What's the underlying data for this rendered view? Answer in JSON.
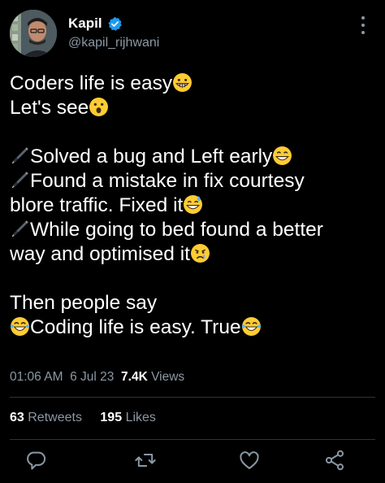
{
  "author": {
    "name": "Kapil",
    "handle": "@kapil_rijhwani",
    "verified": true
  },
  "icons": {
    "more": "more-vertical-icon",
    "verified": "verified-badge-icon",
    "pen": "fountain-pen-emoji",
    "grin": "grinning-face-emoji",
    "wow": "astonished-face-emoji",
    "smile": "smiling-face-emoji",
    "sweat": "sweat-smile-emoji",
    "cry": "crying-face-emoji",
    "laugh": "tears-of-joy-emoji",
    "reply": "reply-icon",
    "retweet": "retweet-icon",
    "like": "heart-icon",
    "share": "share-icon"
  },
  "tweet": {
    "line1": "Coders life is easy",
    "line2": "Let's see",
    "line3": "Solved a bug and Left early",
    "line4": "Found a mistake in fix courtesy",
    "line5": "blore traffic. Fixed it",
    "line6": "While going to bed found a better",
    "line7": "way and optimised it",
    "line8": "Then people say",
    "line9": "Coding life is easy. True"
  },
  "meta": {
    "time": "01:06 AM",
    "date": "6 Jul 23",
    "views_count": "7.4K",
    "views_label": "Views"
  },
  "stats": {
    "retweets_count": "63",
    "retweets_label": "Retweets",
    "likes_count": "195",
    "likes_label": "Likes"
  },
  "colors": {
    "background": "#000000",
    "text": "#ffffff",
    "muted": "#8b98a5",
    "verified": "#1d9bf0",
    "divider": "#2f3336"
  }
}
